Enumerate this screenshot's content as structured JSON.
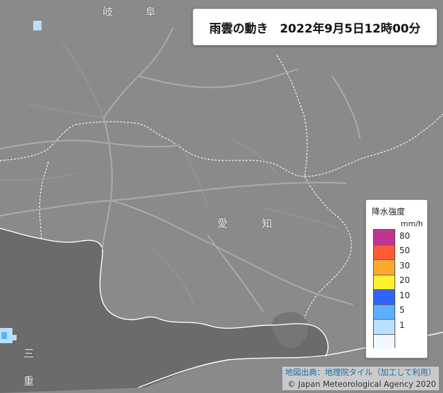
{
  "title": "雨雲の動き　2022年9月5日12時00分",
  "colors": {
    "land": "#8a8a8a",
    "water": "#6b6b6b",
    "coast": "#ffffff",
    "boundary": "#f0f0f0",
    "road": "#a8a8a8"
  },
  "legend": {
    "title": "降水強度",
    "unit": "mm/h",
    "bins": [
      {
        "label": "80",
        "color": "#c2348f"
      },
      {
        "label": "50",
        "color": "#ff5a36"
      },
      {
        "label": "30",
        "color": "#ffa82e"
      },
      {
        "label": "20",
        "color": "#fff02a"
      },
      {
        "label": "10",
        "color": "#2f64ff"
      },
      {
        "label": "5",
        "color": "#5ab1ff"
      },
      {
        "label": "1",
        "color": "#b9dfff"
      },
      {
        "label": "",
        "color": "#f2f7ff"
      }
    ]
  },
  "attribution": {
    "source": "地図出典：地理院タイル（加工して利用）",
    "copyright": "© Japan Meteorological Agency 2020"
  },
  "map_labels": {
    "gifu": [
      "岐",
      "阜"
    ],
    "aichi": [
      "愛",
      "知"
    ],
    "mie": [
      "三",
      "重"
    ]
  },
  "rain_cells": [
    {
      "intensity": "1-5",
      "color": "#b9dfff"
    },
    {
      "intensity": "5-10",
      "color": "#5ab1ff"
    }
  ]
}
